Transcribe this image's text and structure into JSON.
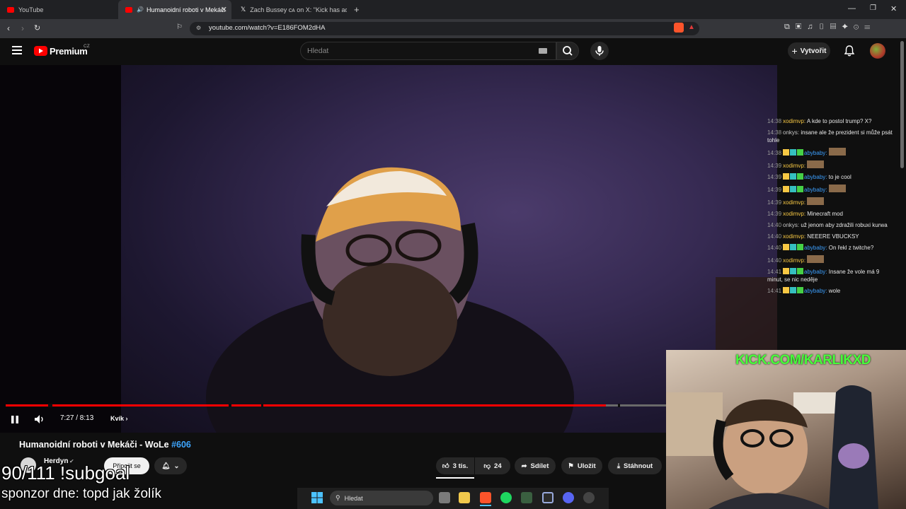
{
  "browser": {
    "tabs": [
      {
        "label": "YouTube"
      },
      {
        "label": "Humanoidní roboti v Mekáči"
      },
      {
        "label": "Zach Bussey ᴄᴀ on X: \"Kick has added"
      }
    ],
    "url": "youtube.com/watch?v=E186FOM2dHA"
  },
  "youtube": {
    "logo_text": "Premium",
    "region": "CZ",
    "search_placeholder": "Hledat",
    "create_label": "Vytvořit"
  },
  "player": {
    "time": "7:27 / 8:13",
    "chapter": "Kvík",
    "progress_fraction": 0.909
  },
  "chat": [
    {
      "time": "14:38",
      "user": "xodimvp",
      "msg": "A kde to postol trump? X?",
      "ucls": "u1"
    },
    {
      "time": "14:38",
      "user": "onkys",
      "msg": "insane ale že prezident si může psát tohle",
      "ucls": "u2"
    },
    {
      "time": "14:38",
      "user": "abybaby",
      "msg": "",
      "ucls": "u3",
      "badges": true
    },
    {
      "time": "14:39",
      "user": "xodimvp",
      "msg": "",
      "ucls": "u1"
    },
    {
      "time": "14:39",
      "user": "abybaby",
      "msg": "to je cool",
      "ucls": "u3",
      "badges": true
    },
    {
      "time": "14:39",
      "user": "abybaby",
      "msg": "",
      "ucls": "u3",
      "badges": true
    },
    {
      "time": "14:39",
      "user": "xodimvp",
      "msg": "",
      "ucls": "u1"
    },
    {
      "time": "14:39",
      "user": "xodimvp",
      "msg": "Minecraft mod",
      "ucls": "u1"
    },
    {
      "time": "14:40",
      "user": "onkys",
      "msg": "už jenom aby zdražili robuxi kurwa",
      "ucls": "u2"
    },
    {
      "time": "14:40",
      "user": "xodimvp",
      "msg": "NEEERE VBUCKSY",
      "ucls": "u1"
    },
    {
      "time": "14:40",
      "user": "abybaby",
      "msg": "On řekl z twitche?",
      "ucls": "u3",
      "badges": true
    },
    {
      "time": "14:40",
      "user": "xodimvp",
      "msg": "",
      "ucls": "u1"
    },
    {
      "time": "14:41",
      "user": "abybaby",
      "msg": "Insane že vole má 9 minut, se nic neděje",
      "ucls": "u3",
      "badges": true
    },
    {
      "time": "14:41",
      "user": "abybaby",
      "msg": "wole",
      "ucls": "u3",
      "badges": true
    }
  ],
  "stream_overlay": {
    "kick_url": "KICK.COM/KARLIKXD",
    "subgoal": "90/111 !subgoal",
    "sponsor": "sponzor dne: topd jak žolík"
  },
  "video": {
    "title": "Humanoidní roboti v Mekáči - WoLe",
    "tag": "#606",
    "channel": "Herdyn",
    "join_label": "Připojit se",
    "likes": "3 tis.",
    "dislikes": "24",
    "share": "Sdílet",
    "save": "Uložit",
    "download": "Stáhnout"
  },
  "taskbar": {
    "search_placeholder": "Hledat"
  },
  "colors": {
    "accent": "#ff0000",
    "kick_green": "#47ff3a",
    "link_blue": "#3ea6ff"
  }
}
